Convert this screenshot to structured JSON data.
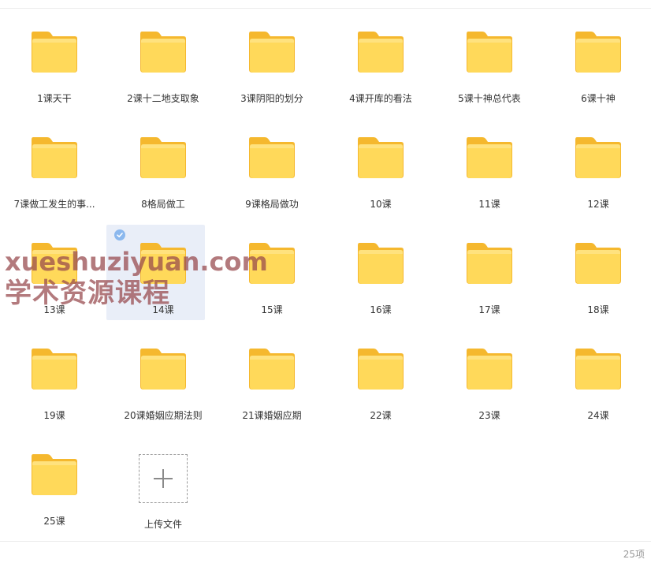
{
  "folders": [
    {
      "label": "1课天干"
    },
    {
      "label": "2课十二地支取象"
    },
    {
      "label": "3课阴阳的划分"
    },
    {
      "label": "4课开库的看法"
    },
    {
      "label": "5课十神总代表"
    },
    {
      "label": "6课十神"
    },
    {
      "label": "7课做工发生的事..."
    },
    {
      "label": "8格局做工"
    },
    {
      "label": "9课格局做功"
    },
    {
      "label": "10课"
    },
    {
      "label": "11课"
    },
    {
      "label": "12课"
    },
    {
      "label": "13课"
    },
    {
      "label": "14课"
    },
    {
      "label": "15课"
    },
    {
      "label": "16课"
    },
    {
      "label": "17课"
    },
    {
      "label": "18课"
    },
    {
      "label": "19课"
    },
    {
      "label": "20课婚姻应期法则"
    },
    {
      "label": "21课婚姻应期"
    },
    {
      "label": "22课"
    },
    {
      "label": "23课"
    },
    {
      "label": "24课"
    },
    {
      "label": "25课"
    }
  ],
  "upload": {
    "label": "上传文件",
    "icon": "plus-icon"
  },
  "selected_index": 13,
  "watermark": {
    "line1": "xueshuziyuan.com",
    "line2": "学术资源课程"
  },
  "footer": {
    "count": "25项"
  },
  "colors": {
    "folder_back": "#f5b82e",
    "folder_front": "#ffd95a",
    "selection": "#e1e8f5",
    "check": "#8bb8ee",
    "watermark": "#96464b"
  }
}
